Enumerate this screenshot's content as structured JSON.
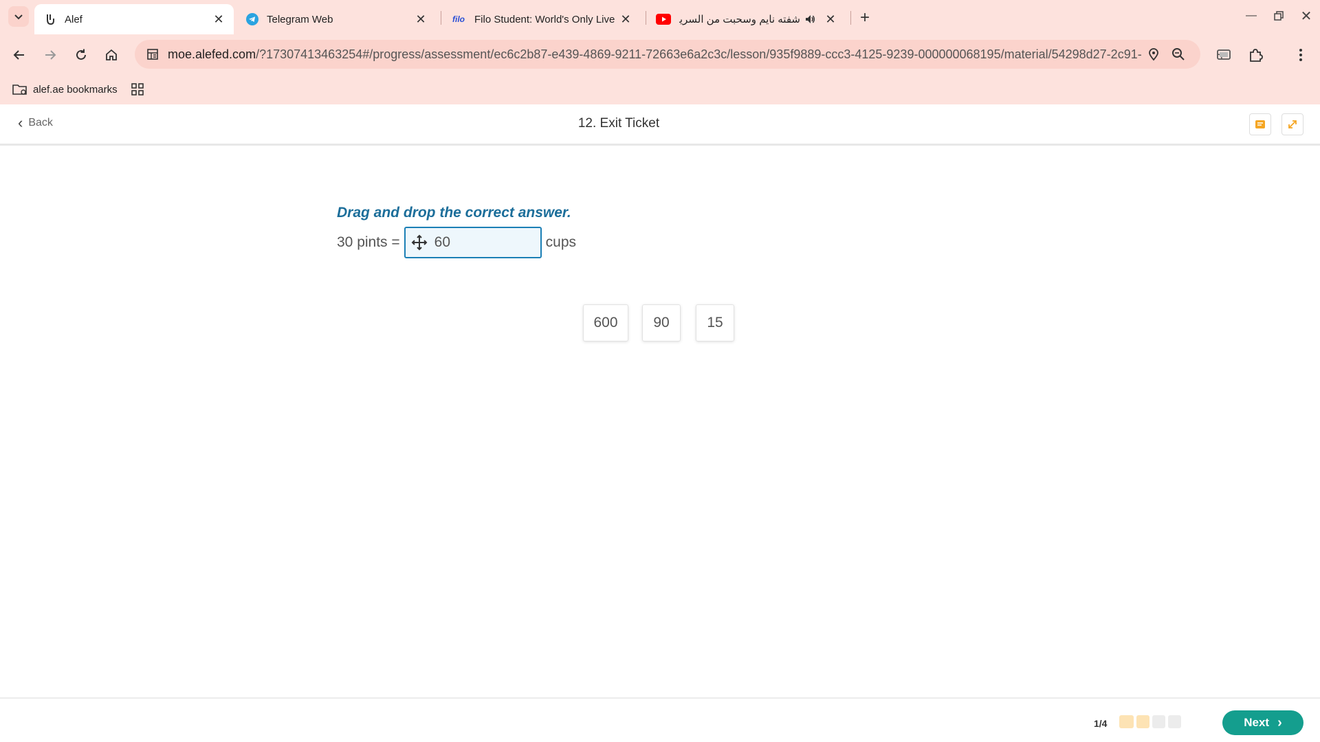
{
  "browser": {
    "tabs": [
      {
        "title": "Alef",
        "icon": "alef-icon",
        "active": true
      },
      {
        "title": "Telegram Web",
        "icon": "telegram-icon",
        "active": false
      },
      {
        "title": "Filo Student: World's Only Live I",
        "icon": "filo-icon",
        "active": false,
        "favicon_text": "filo"
      },
      {
        "title": "شفته نايم وسحبت من السرير",
        "icon": "youtube-icon",
        "active": false
      }
    ],
    "url_host": "moe.alefed.com",
    "url_rest": "/?17307413463254#/progress/assessment/ec6c2b87-e439-4869-9211-72663e6a2c3c/lesson/935f9889-ccc3-4125-9239-000000068195/material/54298d27-2c91-...",
    "bookmarks": [
      {
        "label": "alef.ae bookmarks"
      }
    ],
    "colors": {
      "frame": "#fde2dd",
      "omnibox": "#fbd3cc"
    }
  },
  "header": {
    "back_label": "Back",
    "lesson_title": "12. Exit Ticket"
  },
  "question": {
    "prompt": "Drag and drop the correct answer.",
    "left_text": "30 pints =",
    "dropped_value": "60",
    "right_text": "cups",
    "choices": [
      "600",
      "90",
      "15"
    ]
  },
  "footer": {
    "page_indicator": "1/4",
    "progress_colors": [
      "#fde3b4",
      "#fde3b4",
      "#ececec",
      "#ececec"
    ],
    "next_label": "Next",
    "accent": "#149e8e"
  }
}
